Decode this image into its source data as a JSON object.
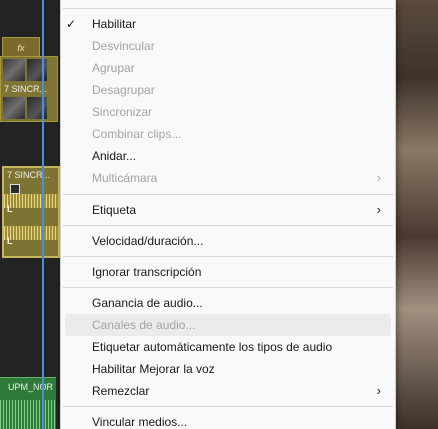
{
  "timeline": {
    "fx_label": "fx",
    "video_clip_name": "7 SINCR...",
    "audio_clip_name": "7 SINCR...",
    "audio_channel_label": "L",
    "green_clip_name": "UPM_NOR"
  },
  "menu": {
    "items": [
      {
        "label": "Habilitar",
        "checked": true
      },
      {
        "label": "Desvincular",
        "disabled": true
      },
      {
        "label": "Agrupar",
        "disabled": true
      },
      {
        "label": "Desagrupar",
        "disabled": true
      },
      {
        "label": "Sincronizar",
        "disabled": true
      },
      {
        "label": "Combinar clips...",
        "disabled": true
      },
      {
        "label": "Anidar..."
      },
      {
        "label": "Multicámara",
        "disabled": true,
        "submenu": true
      },
      {
        "label": "Etiqueta",
        "submenu": true
      },
      {
        "label": "Velocidad/duración..."
      },
      {
        "label": "Ignorar transcripción"
      },
      {
        "label": "Ganancia de audio..."
      },
      {
        "label": "Canales de audio...",
        "disabled": true,
        "highlighted": true
      },
      {
        "label": "Etiquetar automáticamente los tipos de audio"
      },
      {
        "label": "Habilitar Mejorar la voz"
      },
      {
        "label": "Remezclar",
        "submenu": true
      },
      {
        "label": "Vincular medios..."
      }
    ],
    "checkmark_icon": "✓",
    "submenu_icon": "›"
  }
}
